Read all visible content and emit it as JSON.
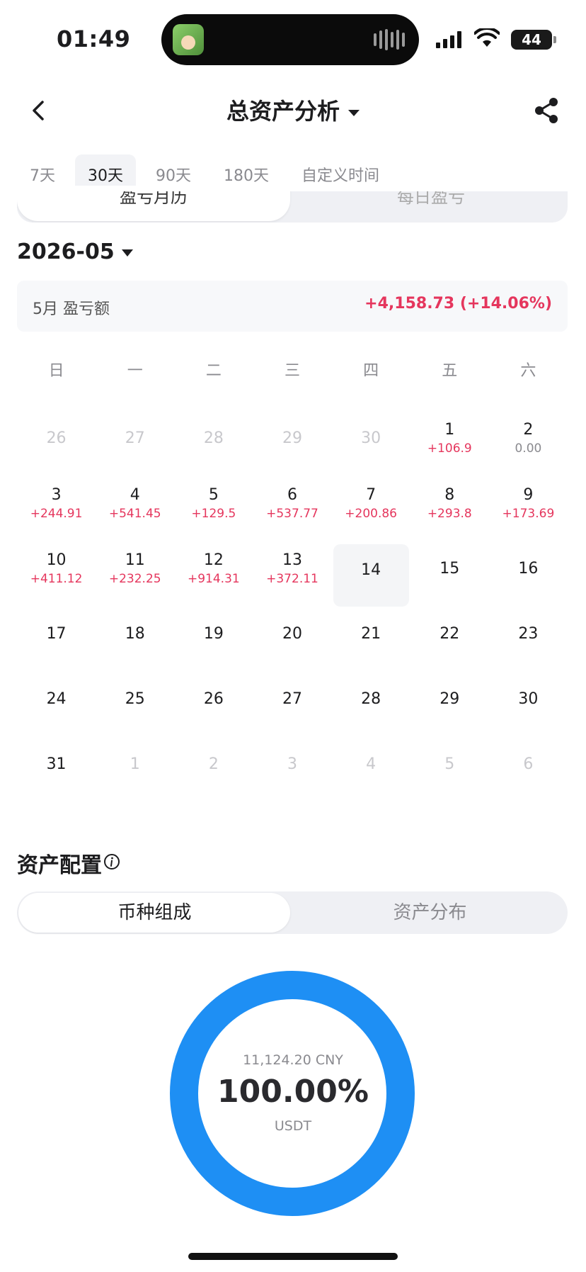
{
  "status_bar": {
    "time": "01:49",
    "battery": "44"
  },
  "nav": {
    "title": "总资产分析"
  },
  "period_tabs": [
    {
      "label": "7天"
    },
    {
      "label": "30天"
    },
    {
      "label": "90天"
    },
    {
      "label": "180天"
    },
    {
      "label": "自定义时间"
    }
  ],
  "selected_period": "30天",
  "view_toggle": {
    "left": "盈亏月历",
    "right": "每日盈亏"
  },
  "month_selector": "2026-05",
  "summary": {
    "label": "5月 盈亏额",
    "value": "+4,158.73 (+14.06%)"
  },
  "weekdays": [
    "日",
    "一",
    "二",
    "三",
    "四",
    "五",
    "六"
  ],
  "calendar_days": [
    {
      "day": "26",
      "pnl": "",
      "muted": true
    },
    {
      "day": "27",
      "pnl": "",
      "muted": true
    },
    {
      "day": "28",
      "pnl": "",
      "muted": true
    },
    {
      "day": "29",
      "pnl": "",
      "muted": true
    },
    {
      "day": "30",
      "pnl": "",
      "muted": true
    },
    {
      "day": "1",
      "pnl": "+106.9"
    },
    {
      "day": "2",
      "pnl": "0.00",
      "zero": true
    },
    {
      "day": "3",
      "pnl": "+244.91"
    },
    {
      "day": "4",
      "pnl": "+541.45"
    },
    {
      "day": "5",
      "pnl": "+129.5"
    },
    {
      "day": "6",
      "pnl": "+537.77"
    },
    {
      "day": "7",
      "pnl": "+200.86"
    },
    {
      "day": "8",
      "pnl": "+293.8"
    },
    {
      "day": "9",
      "pnl": "+173.69"
    },
    {
      "day": "10",
      "pnl": "+411.12"
    },
    {
      "day": "11",
      "pnl": "+232.25"
    },
    {
      "day": "12",
      "pnl": "+914.31"
    },
    {
      "day": "13",
      "pnl": "+372.11"
    },
    {
      "day": "14",
      "pnl": "",
      "today": true
    },
    {
      "day": "15",
      "pnl": ""
    },
    {
      "day": "16",
      "pnl": ""
    },
    {
      "day": "17",
      "pnl": ""
    },
    {
      "day": "18",
      "pnl": ""
    },
    {
      "day": "19",
      "pnl": ""
    },
    {
      "day": "20",
      "pnl": ""
    },
    {
      "day": "21",
      "pnl": ""
    },
    {
      "day": "22",
      "pnl": ""
    },
    {
      "day": "23",
      "pnl": ""
    },
    {
      "day": "24",
      "pnl": ""
    },
    {
      "day": "25",
      "pnl": ""
    },
    {
      "day": "26",
      "pnl": ""
    },
    {
      "day": "27",
      "pnl": ""
    },
    {
      "day": "28",
      "pnl": ""
    },
    {
      "day": "29",
      "pnl": ""
    },
    {
      "day": "30",
      "pnl": ""
    },
    {
      "day": "31",
      "pnl": ""
    },
    {
      "day": "1",
      "pnl": "",
      "muted": true
    },
    {
      "day": "2",
      "pnl": "",
      "muted": true
    },
    {
      "day": "3",
      "pnl": "",
      "muted": true
    },
    {
      "day": "4",
      "pnl": "",
      "muted": true
    },
    {
      "day": "5",
      "pnl": "",
      "muted": true
    },
    {
      "day": "6",
      "pnl": "",
      "muted": true
    }
  ],
  "allocation": {
    "title": "资产配置",
    "tabs": {
      "left": "币种组成",
      "right": "资产分布"
    },
    "donut": {
      "value_cny": "11,124.20 CNY",
      "percent": "100.00%",
      "currency": "USDT",
      "color": "#1e8ff4",
      "fraction": 1.0
    }
  },
  "colors": {
    "positive": "#e5365d",
    "accent": "#1e8ff4"
  }
}
